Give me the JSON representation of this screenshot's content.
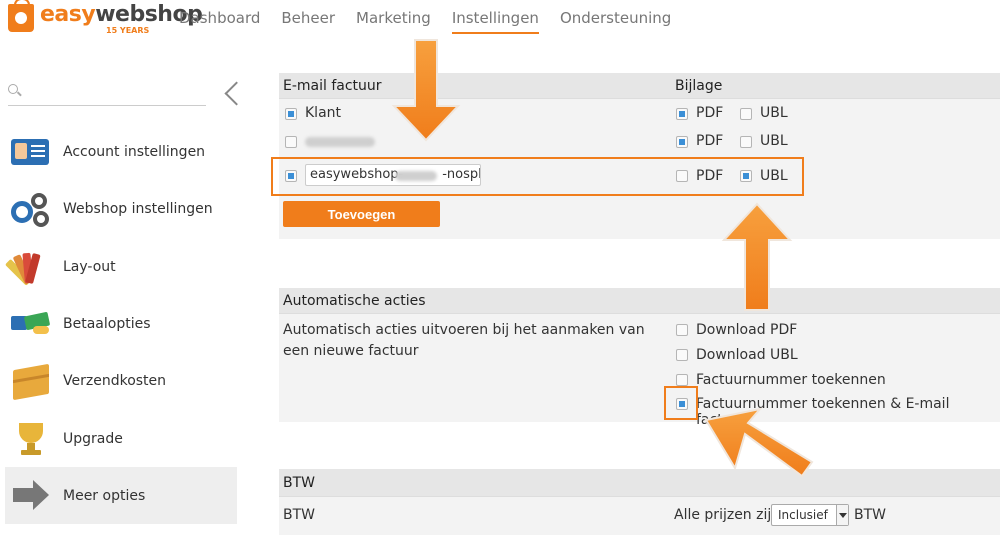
{
  "logo": {
    "word1": "easy",
    "word2": "webshop",
    "tagline": "15 YEARS"
  },
  "nav": [
    {
      "label": "Dashboard"
    },
    {
      "label": "Beheer"
    },
    {
      "label": "Marketing"
    },
    {
      "label": "Instellingen",
      "active": true
    },
    {
      "label": "Ondersteuning"
    }
  ],
  "sidebar": {
    "search_placeholder": "",
    "items": [
      {
        "label": "Account instellingen",
        "icon": "account-card-icon"
      },
      {
        "label": "Webshop instellingen",
        "icon": "gears-icon"
      },
      {
        "label": "Lay-out",
        "icon": "color-fan-icon"
      },
      {
        "label": "Betaalopties",
        "icon": "payment-icon"
      },
      {
        "label": "Verzendkosten",
        "icon": "box-icon"
      },
      {
        "label": "Upgrade",
        "icon": "trophy-icon"
      },
      {
        "label": "Meer opties",
        "icon": "arrow-right-icon",
        "active": true
      }
    ]
  },
  "email_invoice": {
    "heading": "E-mail factuur",
    "attachment_heading": "Bijlage",
    "rows": [
      {
        "label": "Klant",
        "checked": true,
        "pdf": true,
        "ubl": false
      },
      {
        "label": "",
        "checked": false,
        "pdf": true,
        "ubl": false
      },
      {
        "value": "easywebshop-   -nospli",
        "checked": true,
        "pdf": false,
        "ubl": true
      }
    ],
    "pdf_label": "PDF",
    "ubl_label": "UBL",
    "add_button": "Toevoegen"
  },
  "auto_actions": {
    "heading": "Automatische acties",
    "description": "Automatisch acties uitvoeren bij het aanmaken van een nieuwe factuur",
    "options": [
      {
        "label": "Download PDF",
        "checked": false
      },
      {
        "label": "Download UBL",
        "checked": false
      },
      {
        "label": "Factuurnummer toekennen",
        "checked": false
      },
      {
        "label": "Factuurnummer toekennen & E-mail factuur",
        "checked": true
      }
    ]
  },
  "vat": {
    "heading": "BTW",
    "row_label": "BTW",
    "prefix": "Alle prijzen zijn",
    "selected": "Inclusief",
    "suffix": "BTW"
  },
  "colors": {
    "accent": "#f07d1b",
    "checkbox_on": "#3b8fd6",
    "section_bg": "#f3f3f3"
  }
}
